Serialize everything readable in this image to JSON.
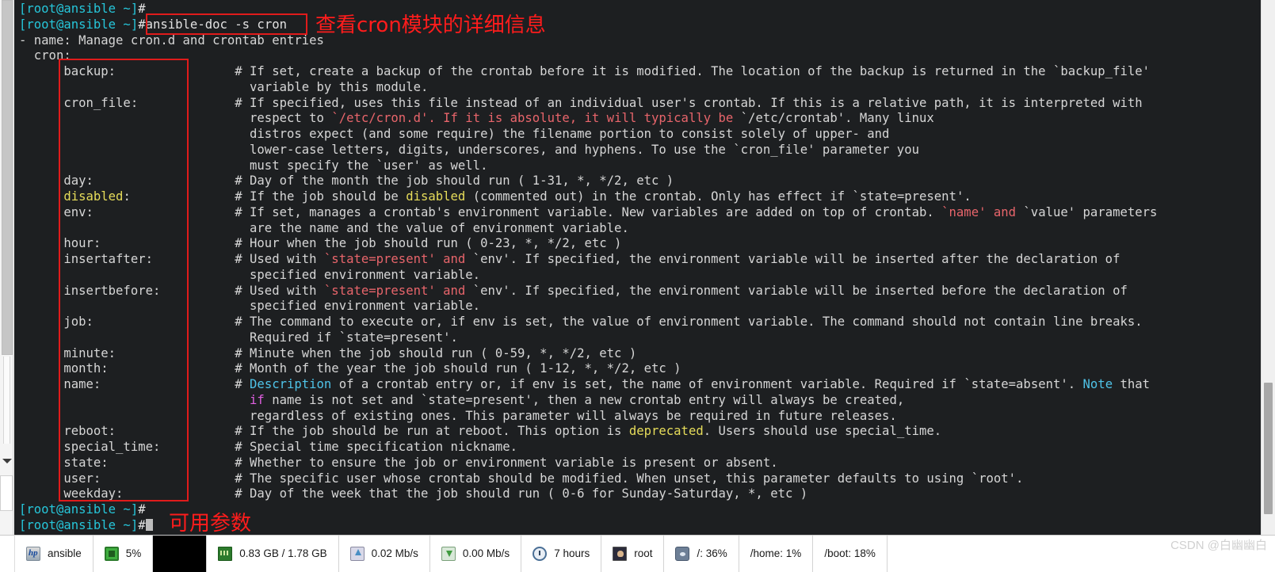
{
  "window": {
    "title": "ansible terminal",
    "background_color": "#1d1f21",
    "foreground_color": "#d6d6d6"
  },
  "annotations": {
    "command_note": "查看cron模块的详细信息",
    "params_note": "可用参数",
    "box_color": "#e01b1b"
  },
  "watermark": "CSDN @白幽幽白",
  "terminal": {
    "prompt": "[root@ansible ~]#",
    "command": "#ansible-doc -s cron",
    "lines": [
      {
        "id": "l1",
        "segments": [
          {
            "t": "[root@ansible ~]",
            "c": "prompt"
          },
          {
            "t": "#",
            "c": "white"
          }
        ]
      },
      {
        "id": "l2",
        "segments": [
          {
            "t": "[root@ansible ~]",
            "c": "prompt"
          },
          {
            "t": "#ansible-doc -s cron",
            "c": "white"
          }
        ]
      },
      {
        "id": "l3",
        "segments": [
          {
            "t": "- name: Manage cron.d and crontab entries",
            "c": "gray"
          }
        ]
      },
      {
        "id": "l4",
        "segments": [
          {
            "t": "  cron:",
            "c": "gray"
          }
        ]
      },
      {
        "id": "l5",
        "segments": [
          {
            "t": "      backup:                # If set, create a backup of the crontab before it is modified. The location of the backup is returned in the `backup_file'",
            "c": "gray"
          }
        ]
      },
      {
        "id": "l6",
        "segments": [
          {
            "t": "                               variable by this module.",
            "c": "gray"
          }
        ]
      },
      {
        "id": "l7",
        "segments": [
          {
            "t": "      cron_file:             # If specified, uses this file instead of an individual user's crontab. If this is a relative path, it is interpreted with",
            "c": "gray"
          }
        ]
      },
      {
        "id": "l8",
        "segments": [
          {
            "t": "                               respect to ",
            "c": "gray"
          },
          {
            "t": "`/etc/cron.d'. If it is absolute, it will typically be ",
            "c": "red"
          },
          {
            "t": "`/etc/crontab'. Many linux",
            "c": "gray"
          }
        ]
      },
      {
        "id": "l9",
        "segments": [
          {
            "t": "                               distros expect (and some require) the filename portion to consist solely of upper- and",
            "c": "gray"
          }
        ]
      },
      {
        "id": "l10",
        "segments": [
          {
            "t": "                               lower-case letters, digits, underscores, and hyphens. To use the `cron_file' parameter you",
            "c": "gray"
          }
        ]
      },
      {
        "id": "l11",
        "segments": [
          {
            "t": "                               must specify the `user' as well.",
            "c": "gray"
          }
        ]
      },
      {
        "id": "l12",
        "segments": [
          {
            "t": "      day:                   # Day of the month the job should run ( 1-31, *, */2, etc )",
            "c": "gray"
          }
        ]
      },
      {
        "id": "l13",
        "segments": [
          {
            "t": "      ",
            "c": "gray"
          },
          {
            "t": "disabled",
            "c": "yellow"
          },
          {
            "t": ":              # If the job should be ",
            "c": "gray"
          },
          {
            "t": "disabled",
            "c": "yellow"
          },
          {
            "t": " (commented out) in the crontab. Only has effect if `state=present'.",
            "c": "gray"
          }
        ]
      },
      {
        "id": "l14",
        "segments": [
          {
            "t": "      env:                   # If set, manages a crontab's environment variable. New variables are added on top of crontab. ",
            "c": "gray"
          },
          {
            "t": "`name' and ",
            "c": "red"
          },
          {
            "t": "`value' parameters",
            "c": "gray"
          }
        ]
      },
      {
        "id": "l15",
        "segments": [
          {
            "t": "                               are the name and the value of environment variable.",
            "c": "gray"
          }
        ]
      },
      {
        "id": "l16",
        "segments": [
          {
            "t": "      hour:                  # Hour when the job should run ( 0-23, *, */2, etc )",
            "c": "gray"
          }
        ]
      },
      {
        "id": "l17",
        "segments": [
          {
            "t": "      insertafter:           # Used with ",
            "c": "gray"
          },
          {
            "t": "`state=present' and ",
            "c": "red"
          },
          {
            "t": "`env'. If specified, the environment variable will be inserted after the declaration of",
            "c": "gray"
          }
        ]
      },
      {
        "id": "l18",
        "segments": [
          {
            "t": "                               specified environment variable.",
            "c": "gray"
          }
        ]
      },
      {
        "id": "l19",
        "segments": [
          {
            "t": "      insertbefore:          # Used with ",
            "c": "gray"
          },
          {
            "t": "`state=present' and ",
            "c": "red"
          },
          {
            "t": "`env'. If specified, the environment variable will be inserted before the declaration of",
            "c": "gray"
          }
        ]
      },
      {
        "id": "l20",
        "segments": [
          {
            "t": "                               specified environment variable.",
            "c": "gray"
          }
        ]
      },
      {
        "id": "l21",
        "segments": [
          {
            "t": "      job:                   # The command to execute or, if env is set, the value of environment variable. The command should not contain line breaks.",
            "c": "gray"
          }
        ]
      },
      {
        "id": "l22",
        "segments": [
          {
            "t": "                               Required if `state=present'.",
            "c": "gray"
          }
        ]
      },
      {
        "id": "l23",
        "segments": [
          {
            "t": "      minute:                # Minute when the job should run ( 0-59, *, */2, etc )",
            "c": "gray"
          }
        ]
      },
      {
        "id": "l24",
        "segments": [
          {
            "t": "      month:                 # Month of the year the job should run ( 1-12, *, */2, etc )",
            "c": "gray"
          }
        ]
      },
      {
        "id": "l25",
        "segments": [
          {
            "t": "      name:                  # ",
            "c": "gray"
          },
          {
            "t": "Description",
            "c": "cyan"
          },
          {
            "t": " of a crontab entry or, if env is set, the name of environment variable. Required if `state=absent'. ",
            "c": "gray"
          },
          {
            "t": "Note",
            "c": "cyan"
          },
          {
            "t": " that",
            "c": "gray"
          }
        ]
      },
      {
        "id": "l26",
        "segments": [
          {
            "t": "                               ",
            "c": "gray"
          },
          {
            "t": "if",
            "c": "mag"
          },
          {
            "t": " name is not set and `state=present', then a new crontab entry will always be created,",
            "c": "gray"
          }
        ]
      },
      {
        "id": "l27",
        "segments": [
          {
            "t": "                               regardless of existing ones. This parameter will always be required in future releases.",
            "c": "gray"
          }
        ]
      },
      {
        "id": "l28",
        "segments": [
          {
            "t": "      reboot:                # If the job should be run at reboot. This option is ",
            "c": "gray"
          },
          {
            "t": "deprecated",
            "c": "yellow"
          },
          {
            "t": ". Users should use special_time.",
            "c": "gray"
          }
        ]
      },
      {
        "id": "l29",
        "segments": [
          {
            "t": "      special_time:          # Special time specification nickname.",
            "c": "gray"
          }
        ]
      },
      {
        "id": "l30",
        "segments": [
          {
            "t": "      state:                 # Whether to ensure the job or environment variable is present or absent.",
            "c": "gray"
          }
        ]
      },
      {
        "id": "l31",
        "segments": [
          {
            "t": "      user:                  # The specific user whose crontab should be modified. When unset, this parameter defaults to using `root'.",
            "c": "gray"
          }
        ]
      },
      {
        "id": "l32",
        "segments": [
          {
            "t": "      weekday:               # Day of the week that the job should run ( 0-6 for Sunday-Saturday, *, etc )",
            "c": "gray"
          }
        ]
      },
      {
        "id": "l33",
        "segments": [
          {
            "t": "[root@ansible ~]",
            "c": "prompt"
          },
          {
            "t": "#",
            "c": "white"
          }
        ]
      },
      {
        "id": "l34",
        "segments": [
          {
            "t": "[root@ansible ~]",
            "c": "prompt"
          },
          {
            "t": "#",
            "c": "white"
          },
          {
            "t": "\u0000CURSOR",
            "c": "cursor"
          }
        ]
      }
    ],
    "parameters": [
      "backup:",
      "cron_file:",
      "day:",
      "disabled:",
      "env:",
      "hour:",
      "insertafter:",
      "insertbefore:",
      "job:",
      "minute:",
      "month:",
      "name:",
      "reboot:",
      "special_time:",
      "state:",
      "user:",
      "weekday:"
    ]
  },
  "taskbar": {
    "items": [
      {
        "icon": "hp-logo-icon",
        "icon_class": "ic-hp",
        "label": "ansible"
      },
      {
        "icon": "cpu-icon",
        "icon_class": "ic-cpu",
        "label": "5%"
      },
      {
        "icon": "cpu-graph-icon",
        "icon_class": "black",
        "label": ""
      },
      {
        "icon": "memory-icon",
        "icon_class": "ic-ram",
        "label": "0.83 GB / 1.78 GB"
      },
      {
        "icon": "network-upload-icon",
        "icon_class": "ic-up",
        "label": "0.02 Mb/s"
      },
      {
        "icon": "network-download-icon",
        "icon_class": "ic-down",
        "label": "0.00 Mb/s"
      },
      {
        "icon": "uptime-clock-icon",
        "icon_class": "ic-clock",
        "label": "7 hours"
      },
      {
        "icon": "user-icon",
        "icon_class": "ic-user",
        "label": "root"
      },
      {
        "icon": "disk-icon",
        "icon_class": "ic-disk",
        "label": "/: 36%"
      },
      {
        "icon": "none",
        "icon_class": "none",
        "label": "/home: 1%"
      },
      {
        "icon": "none",
        "icon_class": "none",
        "label": "/boot: 18%"
      }
    ]
  }
}
